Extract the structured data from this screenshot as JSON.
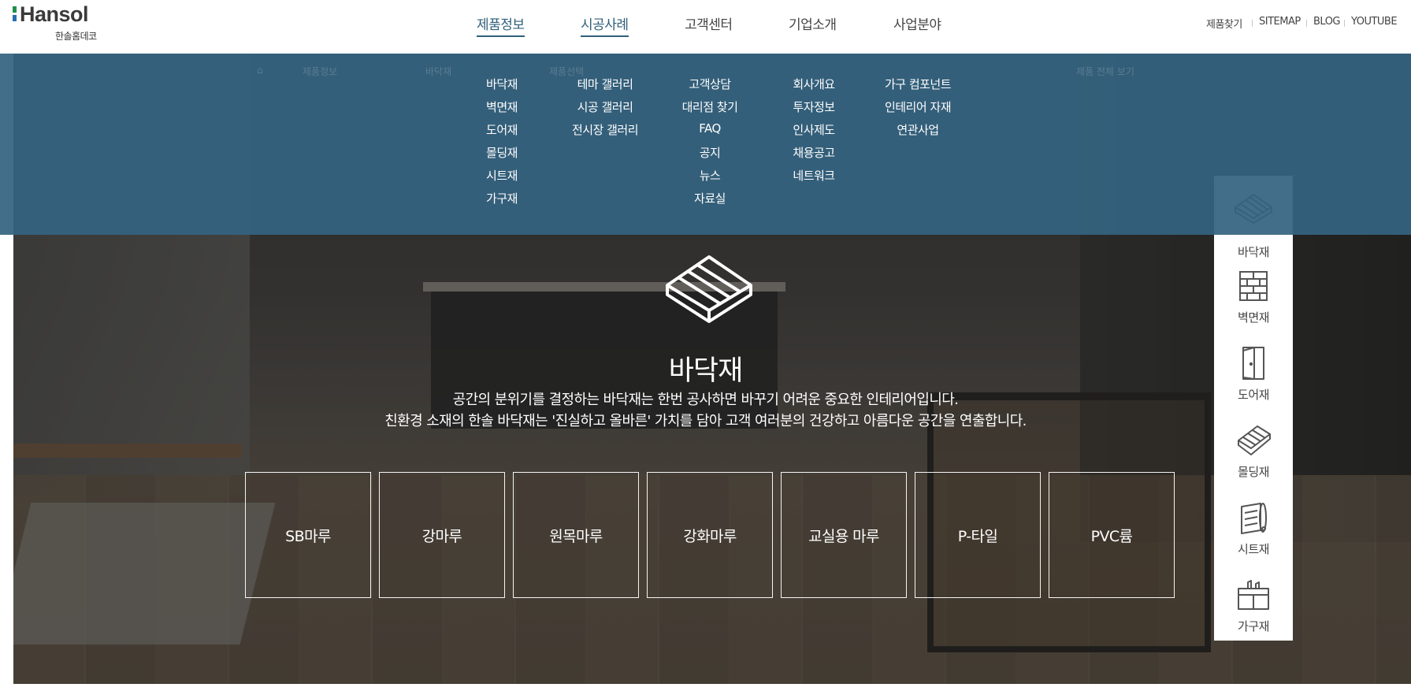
{
  "logo": {
    "brand": "Hansol",
    "sub": "한솔홈데코",
    "colors": [
      "#1f8f4e",
      "#2a6db0",
      "#e0a21a"
    ]
  },
  "gnb": [
    {
      "label": "제품정보",
      "active": true
    },
    {
      "label": "시공사례",
      "active": true
    },
    {
      "label": "고객센터",
      "active": false
    },
    {
      "label": "기업소개",
      "active": false
    },
    {
      "label": "사업분야",
      "active": false
    }
  ],
  "util": [
    "제품찾기",
    "SITEMAP",
    "BLOG",
    "YOUTUBE"
  ],
  "ghost_bar": {
    "home_icon": "home-icon",
    "select_1": "제품정보",
    "select_2": "바닥재",
    "select_3": "제품선택",
    "view_all": "제품 전체 보기"
  },
  "dropdown": {
    "products": [
      "바닥재",
      "벽면재",
      "도어재",
      "몰딩재",
      "시트재",
      "가구재"
    ],
    "cases": [
      "테마 갤러리",
      "시공 갤러리",
      "전시장 갤러리"
    ],
    "support": [
      "고객상담",
      "대리점 찾기",
      "FAQ",
      "공지",
      "뉴스",
      "자료실"
    ],
    "company": [
      "회사개요",
      "투자정보",
      "인사제도",
      "채용공고",
      "네트워크"
    ],
    "business": [
      "가구 컴포넌트",
      "인테리어 자재",
      "연관사업"
    ]
  },
  "hero": {
    "icon": "floor-plank-icon",
    "title": "바닥재",
    "desc_line1": "공간의 분위기를 결정하는 바닥재는 한번 공사하면 바꾸기 어려운 중요한 인테리어입니다.",
    "desc_line2": "친환경 소재의 한솔 바닥재는 '진실하고 올바른' 가치를 담아 고객 여러분의 건강하고 아름다운 공간을 연출합니다."
  },
  "categories": [
    "SB마루",
    "강마루",
    "원목마루",
    "강화마루",
    "교실용 마루",
    "P-타일",
    "PVC륨"
  ],
  "quick_menu": [
    {
      "label": "바닥재",
      "icon": "floor-icon"
    },
    {
      "label": "벽면재",
      "icon": "wall-icon"
    },
    {
      "label": "도어재",
      "icon": "door-icon"
    },
    {
      "label": "몰딩재",
      "icon": "molding-icon"
    },
    {
      "label": "시트재",
      "icon": "sheet-roll-icon"
    },
    {
      "label": "가구재",
      "icon": "furniture-icon"
    }
  ],
  "colors": {
    "accent": "#2f5f7a",
    "dropdown_bg": "#356380"
  }
}
